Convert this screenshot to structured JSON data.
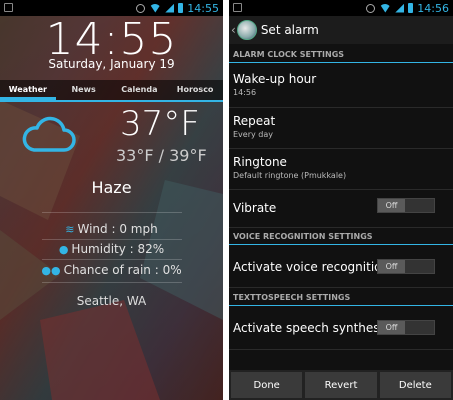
{
  "left": {
    "status": {
      "time": "14:55"
    },
    "clock": {
      "time": "14:55",
      "date": "Saturday, January 19"
    },
    "tabs": [
      "Weather",
      "News",
      "Calenda",
      "Horosco"
    ],
    "weather": {
      "icon": "cloud-icon",
      "temperature": "37°F",
      "min_max": "33°F / 39°F",
      "condition": "Haze",
      "wind": "Wind : 0 mph",
      "humidity": "Humidity : 82%",
      "rain": "Chance of rain : 0%",
      "city": "Seattle, WA"
    },
    "accent": "#33b5e5"
  },
  "right": {
    "status": {
      "time": "14:56"
    },
    "title": "Set alarm",
    "sections": {
      "alarm": "ALARM CLOCK SETTINGS",
      "voice": "VOICE RECOGNITION SETTINGS",
      "tts": "TEXTTOSPEECH SETTINGS"
    },
    "settings": {
      "wakeup_title": "Wake-up hour",
      "wakeup_value": "14:56",
      "repeat_title": "Repeat",
      "repeat_value": "Every day",
      "ringtone_title": "Ringtone",
      "ringtone_value": "Default ringtone (Pmukkale)",
      "vibrate_title": "Vibrate",
      "vibrate_state": "Off",
      "voice_title": "Activate voice recognition",
      "voice_state": "Off",
      "speech_title": "Activate speech synthesis",
      "speech_state": "Off"
    },
    "buttons": {
      "done": "Done",
      "revert": "Revert",
      "delete": "Delete"
    }
  }
}
